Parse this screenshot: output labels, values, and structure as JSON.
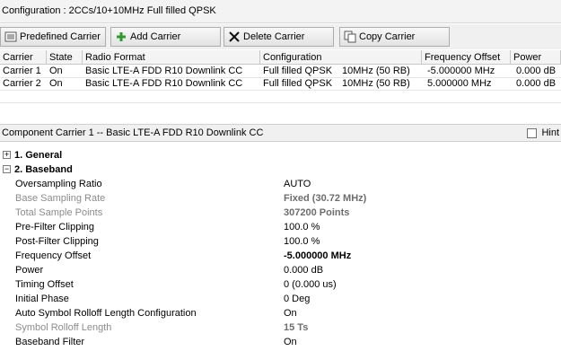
{
  "config_title": "Configuration : 2CCs/10+10MHz Full filled QPSK",
  "toolbar": {
    "predefined_label": "Predefined Carrier",
    "add_label": "Add Carrier",
    "delete_label": "Delete Carrier",
    "copy_label": "Copy Carrier"
  },
  "grid": {
    "headers": [
      "Carrier",
      "State",
      "Radio Format",
      "Configuration",
      "Frequency Offset",
      "Power"
    ],
    "rows": [
      {
        "carrier": "Carrier 1",
        "state": "On",
        "format": "Basic LTE-A FDD R10 Downlink CC",
        "config": "Full filled QPSK",
        "bandwidth": "10MHz (50 RB)",
        "freq": "-5.000000 MHz",
        "power": "0.000 dB"
      },
      {
        "carrier": "Carrier 2",
        "state": "On",
        "format": "Basic LTE-A FDD R10 Downlink CC",
        "config": "Full filled QPSK",
        "bandwidth": "10MHz (50 RB)",
        "freq": "5.000000 MHz",
        "power": "0.000 dB"
      }
    ]
  },
  "component_header": "Component Carrier 1 -- Basic LTE-A FDD R10 Downlink CC",
  "hint_label": "Hint",
  "sections": [
    {
      "label": "1. General",
      "expander": "+"
    },
    {
      "label": "2. Baseband",
      "expander": "−"
    }
  ],
  "properties": [
    {
      "name": "Oversampling Ratio",
      "value": "AUTO"
    },
    {
      "name": "Base Sampling Rate",
      "value": "Fixed (30.72 MHz)"
    },
    {
      "name": "Total Sample Points",
      "value": "307200 Points"
    },
    {
      "name": "Pre-Filter Clipping",
      "value": "100.0 %"
    },
    {
      "name": "Post-Filter Clipping",
      "value": "100.0 %"
    },
    {
      "name": "Frequency Offset",
      "value": "-5.000000 MHz"
    },
    {
      "name": "Power",
      "value": "0.000 dB"
    },
    {
      "name": "Timing Offset",
      "value": "0 (0.000 us)"
    },
    {
      "name": "Initial Phase",
      "value": "0 Deg"
    },
    {
      "name": "Auto Symbol Rolloff Length Configuration",
      "value": "On"
    },
    {
      "name": "Symbol Rolloff Length",
      "value": "15 Ts"
    },
    {
      "name": "Baseband Filter",
      "value": "On"
    }
  ],
  "colors": {
    "accent_green": "#2e9a2e",
    "disabled_text": "#8c8c8c"
  }
}
